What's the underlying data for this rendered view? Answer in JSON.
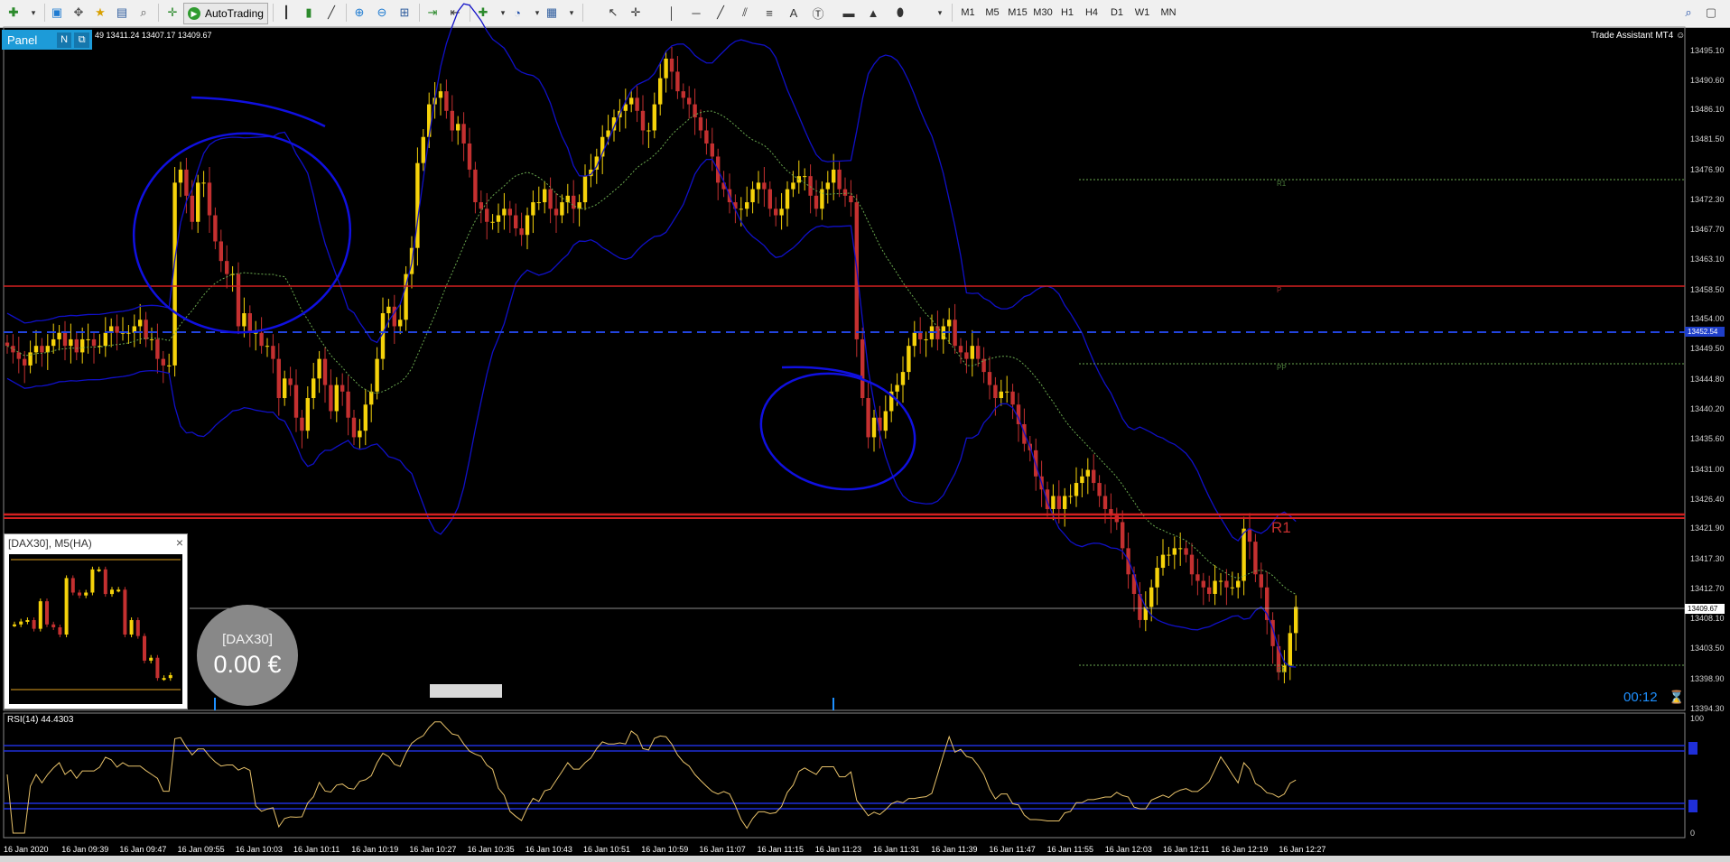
{
  "toolbar": {
    "autotrading_label": "AutoTrading",
    "timeframes": [
      "M1",
      "M5",
      "M15",
      "M30",
      "H1",
      "H4",
      "D1",
      "W1",
      "MN"
    ]
  },
  "panel": {
    "title": "Panel",
    "btn_n": "N",
    "btn_close": "⧉"
  },
  "ohlc_text": "49 13411.24 13407.17 13409.67",
  "trade_assistant": "Trade Assistant MT4 ☺",
  "price_axis": [
    "13495.10",
    "13490.60",
    "13486.10",
    "13481.50",
    "13476.90",
    "13472.30",
    "13467.70",
    "13463.10",
    "13458.50",
    "13454.00",
    "13449.50",
    "13444.80",
    "13440.20",
    "13435.60",
    "13431.00",
    "13426.40",
    "13421.90",
    "13417.30",
    "13412.70",
    "13408.10",
    "13403.50",
    "13398.90",
    "13394.30"
  ],
  "current_price": "13409.67",
  "dashed_level": "13452.54",
  "pivot_labels": {
    "r1_small": "R1",
    "r1_large": "R1",
    "p": "P",
    "s1": "S1",
    "pp": "PP"
  },
  "mini_chart": {
    "title": "[DAX30], M5(HA)",
    "close": "×"
  },
  "balance": {
    "symbol": "[DAX30]",
    "value": "0.00 €"
  },
  "countdown": "00:12",
  "rsi": {
    "label": "RSI(14) 44.4303",
    "scale_top": "100",
    "scale_bottom": "0"
  },
  "time_axis": [
    "16 Jan 2020",
    "16 Jan 09:39",
    "16 Jan 09:47",
    "16 Jan 09:55",
    "16 Jan 10:03",
    "16 Jan 10:11",
    "16 Jan 10:19",
    "16 Jan 10:27",
    "16 Jan 10:35",
    "16 Jan 10:43",
    "16 Jan 10:51",
    "16 Jan 10:59",
    "16 Jan 11:07",
    "16 Jan 11:15",
    "16 Jan 11:23",
    "16 Jan 11:31",
    "16 Jan 11:39",
    "16 Jan 11:47",
    "16 Jan 11:55",
    "16 Jan 12:03",
    "16 Jan 12:11",
    "16 Jan 12:19",
    "16 Jan 12:27"
  ],
  "colors": {
    "bull": "#f5d20a",
    "bear": "#c43030",
    "band": "#1010c8",
    "mid": "#6aa84f",
    "hline": "#d42020",
    "annot": "#1010e0",
    "rsi": "#e8c26a"
  },
  "chart_data": {
    "type": "candlestick",
    "symbol": "DAX30",
    "timeframe": "M1",
    "ylim": [
      13394.3,
      13499.0
    ],
    "closes": [
      13450,
      13449,
      13448,
      13447,
      13449,
      13450,
      13449,
      13450,
      13451,
      13452,
      13450,
      13451,
      13449,
      13451,
      13451,
      13450,
      13450,
      13452,
      13453,
      13452,
      13452,
      13452,
      13453,
      13454,
      13451,
      13451,
      13448,
      13447,
      13447,
      13475,
      13477,
      13473,
      13469,
      13475,
      13475,
      13470,
      13466,
      13463,
      13461,
      13461,
      13453,
      13455,
      13452,
      13452,
      13450,
      13450,
      13448,
      13442,
      13445,
      13444,
      13439,
      13437,
      13442,
      13445,
      13448,
      13444,
      13440,
      13444,
      13443,
      13439,
      13436,
      13437,
      13441,
      13443,
      13448,
      13455,
      13456,
      13453,
      13454,
      13461,
      13465,
      13478,
      13482,
      13487,
      13488,
      13489,
      13486,
      13483,
      13484,
      13481,
      13477,
      13472,
      13471,
      13469,
      13469,
      13470,
      13471,
      13470,
      13468,
      13467,
      13470,
      13472,
      13472,
      13474,
      13471,
      13470,
      13472,
      13473,
      13471,
      13472,
      13476,
      13477,
      13479,
      13482,
      13483,
      13485,
      13486,
      13487,
      13488,
      13486,
      13483,
      13483,
      13487,
      13491,
      13494,
      13492,
      13489,
      13488,
      13487,
      13485,
      13483,
      13481,
      13479,
      13475,
      13474,
      13472,
      13471,
      13471,
      13472,
      13474,
      13475,
      13474,
      13471,
      13470,
      13471,
      13474,
      13475,
      13476,
      13476,
      13473,
      13471,
      13474,
      13475,
      13477,
      13474,
      13473,
      13472,
      13451,
      13442,
      13436,
      13439,
      13437,
      13440,
      13443,
      13444,
      13446,
      13450,
      13452,
      13451,
      13451,
      13453,
      13451,
      13453,
      13454,
      13450,
      13449,
      13448,
      13450,
      13448,
      13446,
      13444,
      13442,
      13443,
      13443,
      13441,
      13438,
      13435,
      13434,
      13430,
      13428,
      13425,
      13427,
      13425,
      13427,
      13427,
      13429,
      13430,
      13431,
      13429,
      13427,
      13425,
      13424,
      13423,
      13419,
      13415,
      13412,
      13408,
      13410,
      13413,
      13416,
      13418,
      13418,
      13419,
      13419,
      13418,
      13415,
      13414,
      13413,
      13412,
      13414,
      13414,
      13413,
      13413,
      13414,
      13422,
      13420,
      13415,
      13413,
      13408,
      13404,
      13400,
      13401,
      13406,
      13410
    ]
  }
}
